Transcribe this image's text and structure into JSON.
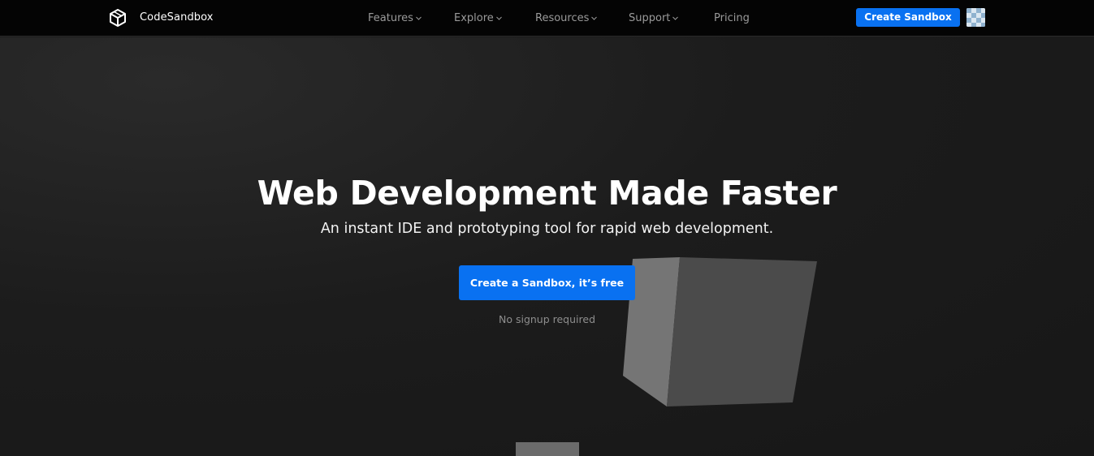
{
  "header": {
    "brand": "CodeSandbox",
    "logo_icon": "codesandbox-cube-icon",
    "nav": [
      {
        "label": "Features",
        "has_dropdown": true
      },
      {
        "label": "Explore",
        "has_dropdown": true
      },
      {
        "label": "Resources",
        "has_dropdown": true
      },
      {
        "label": "Support",
        "has_dropdown": true
      },
      {
        "label": "Pricing",
        "has_dropdown": false
      }
    ],
    "create_button": "Create Sandbox",
    "avatar_icon": "user-avatar-icon"
  },
  "hero": {
    "title": "Web Development Made Faster",
    "subtitle": "An instant IDE and prototyping tool for rapid web development.",
    "cta_button": "Create a Sandbox, it’s free",
    "cta_note": "No signup required"
  },
  "colors": {
    "accent": "#0971f1",
    "background": "#1b1b1b",
    "topbar": "#040404"
  }
}
